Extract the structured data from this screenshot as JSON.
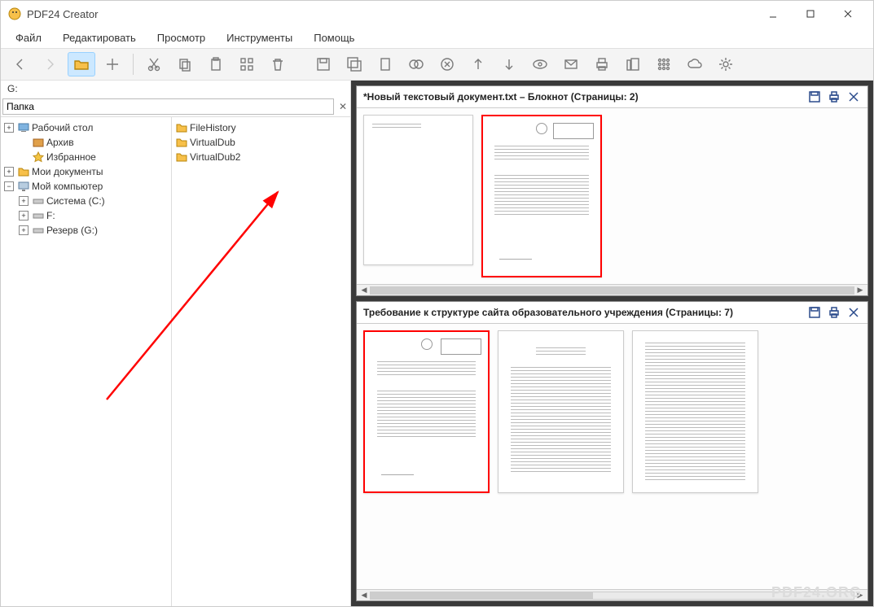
{
  "window": {
    "title": "PDF24 Creator"
  },
  "menu": {
    "items": [
      "Файл",
      "Редактировать",
      "Просмотр",
      "Инструменты",
      "Помощь"
    ]
  },
  "left": {
    "drive": "G:",
    "folder_label": "Папка",
    "tree": {
      "desktop": "Рабочий стол",
      "archive": "Архив",
      "favorites": "Избранное",
      "mydocs": "Мои документы",
      "mycomputer": "Мой компьютер",
      "system_c": "Система (C:)",
      "drive_f": "F:",
      "reserve_g": "Резерв (G:)"
    },
    "files": [
      "FileHistory",
      "VirtualDub",
      "VirtualDub2"
    ]
  },
  "docs": [
    {
      "title": "*Новый текстовый документ.txt – Блокнот (Страницы: 2)"
    },
    {
      "title": "Требование к структуре сайта образовательного учреждения (Страницы: 7)"
    }
  ],
  "watermark": "PDF24.ORG"
}
